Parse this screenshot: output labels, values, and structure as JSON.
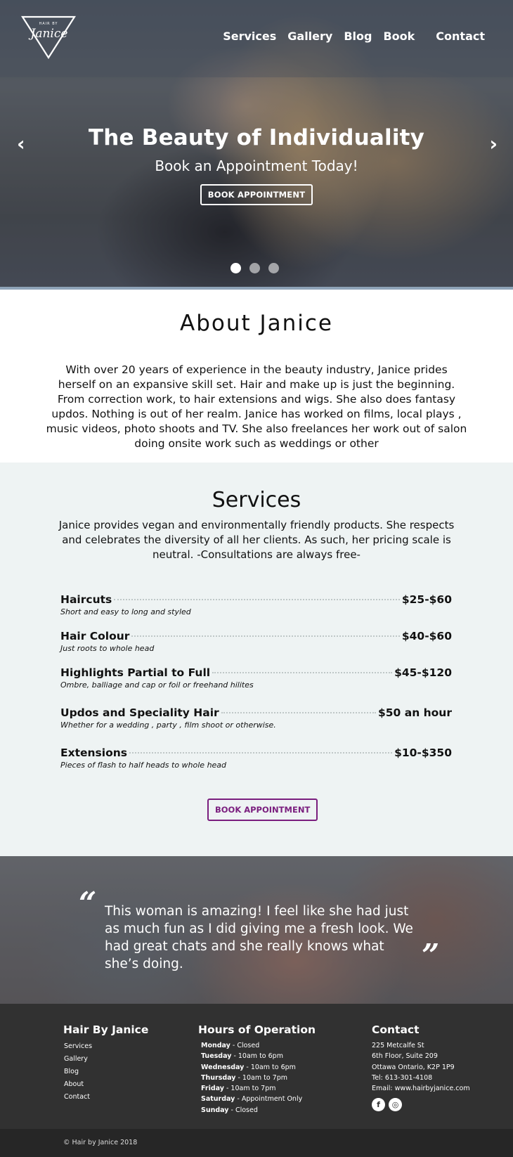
{
  "nav": {
    "logo_small": "HAIR BY",
    "logo_script": "Janice",
    "items": [
      "Services",
      "Gallery",
      "Blog",
      "Book",
      "Contact"
    ]
  },
  "hero": {
    "title": "The Beauty of Individuality",
    "subtitle": "Book an Appointment Today!",
    "button": "BOOK APPOINTMENT",
    "prev": "‹",
    "next": "›",
    "slide_count": 3,
    "active_slide": 1
  },
  "about": {
    "title": "About Janice",
    "body": "With over 20 years of experience in the beauty industry, Janice prides herself on an expansive skill set. Hair and make up is just the beginning. From correction work, to hair extensions and wigs. She also does fantasy updos. Nothing is out of her realm. Janice has worked on films, local plays , music videos, photo shoots and TV. She also freelances her work out of salon doing onsite work such as weddings or other"
  },
  "services": {
    "title": "Services",
    "intro": "Janice provides vegan and environmentally friendly products. She respects and celebrates the diversity of all her clients. As such, her pricing scale is neutral. -Consultations are always free-",
    "items": [
      {
        "name": "Haircuts",
        "price": "$25-$60",
        "desc": "Short and easy to long and styled"
      },
      {
        "name": "Hair Colour",
        "price": "$40-$60",
        "desc": "Just roots to whole head"
      },
      {
        "name": "Highlights Partial to Full",
        "price": "$45-$120",
        "desc": "Ombre, balliage and cap or foil or freehand hilites"
      },
      {
        "name": "Updos and Speciality Hair",
        "price": "$50 an hour",
        "desc": "Whether for a wedding , party , film shoot or otherwise."
      },
      {
        "name": "Extensions",
        "price": "$10-$350",
        "desc": "Pieces of flash to half heads to whole head"
      }
    ],
    "button": "BOOK APPOINTMENT"
  },
  "testimonial": {
    "open_mark": "“",
    "close_mark": "”",
    "text": "This woman is amazing! I feel like she had just as much fun as I did giving me a fresh look. We had great chats and she really knows what she’s doing."
  },
  "footer": {
    "brand": {
      "title": "Hair By Janice",
      "links": [
        "Services",
        "Gallery",
        "Blog",
        "About",
        "Contact"
      ]
    },
    "hours": {
      "title": "Hours of Operation",
      "rows": [
        {
          "day": "Monday",
          "time": " - Closed"
        },
        {
          "day": "Tuesday",
          "time": " - 10am to 6pm"
        },
        {
          "day": "Wednesday",
          "time": " - 10am to 6pm"
        },
        {
          "day": "Thursday",
          "time": " - 10am to 7pm"
        },
        {
          "day": "Friday",
          "time": " - 10am to 7pm"
        },
        {
          "day": "Saturday",
          "time": " - Appointment Only"
        },
        {
          "day": "Sunday",
          "time": " - Closed"
        }
      ]
    },
    "contact": {
      "title": "Contact",
      "lines": [
        "225 Metcalfe St",
        "6th Floor, Suite 209",
        "Ottawa Ontario, K2P 1P9",
        "Tel: 613-301-4108",
        "Email: www.hairbyjanice.com"
      ],
      "social": [
        {
          "icon": "facebook-icon",
          "glyph": "f"
        },
        {
          "icon": "instagram-icon",
          "glyph": "◎"
        }
      ]
    },
    "copyright": "© Hair by Janice 2018"
  },
  "colors": {
    "accent_purple": "#7a1e7e",
    "services_bg": "#eef3f3",
    "footer_bg": "#313131",
    "footer_bottom_bg": "#262626"
  }
}
